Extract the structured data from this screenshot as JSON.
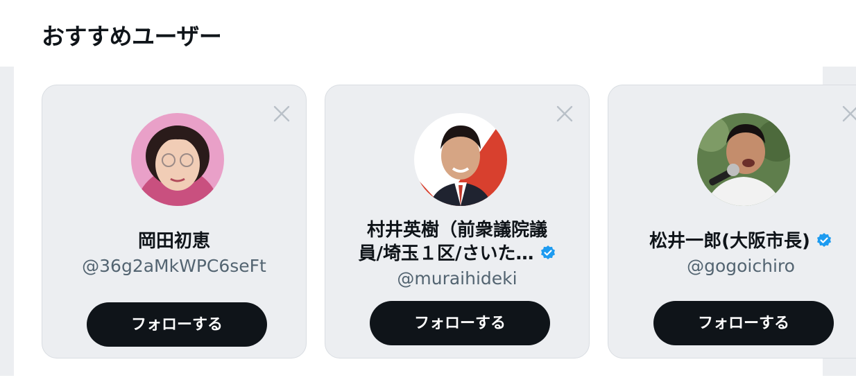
{
  "section": {
    "title": "おすすめユーザー"
  },
  "users": [
    {
      "name": "岡田初恵",
      "handle": "@36g2aMkWPC6seFt",
      "verified": false,
      "follow_label": "フォローする",
      "avatar_icon": "avatar-woman-pink-background"
    },
    {
      "name_line1": "村井英樹（前衆議院議",
      "name_line2": "員/埼玉１区/さいた…",
      "handle": "@muraihideki",
      "verified": true,
      "follow_label": "フォローする",
      "avatar_icon": "avatar-man-red-white-background"
    },
    {
      "name": "松井一郎(大阪市長)",
      "handle": "@gogoichiro",
      "verified": true,
      "follow_label": "フォローする",
      "avatar_icon": "avatar-man-microphone"
    }
  ],
  "colors": {
    "card_bg": "#eceef1",
    "button_bg": "#0f1419",
    "verified_blue": "#1d9bf0",
    "handle_gray": "#536471"
  }
}
